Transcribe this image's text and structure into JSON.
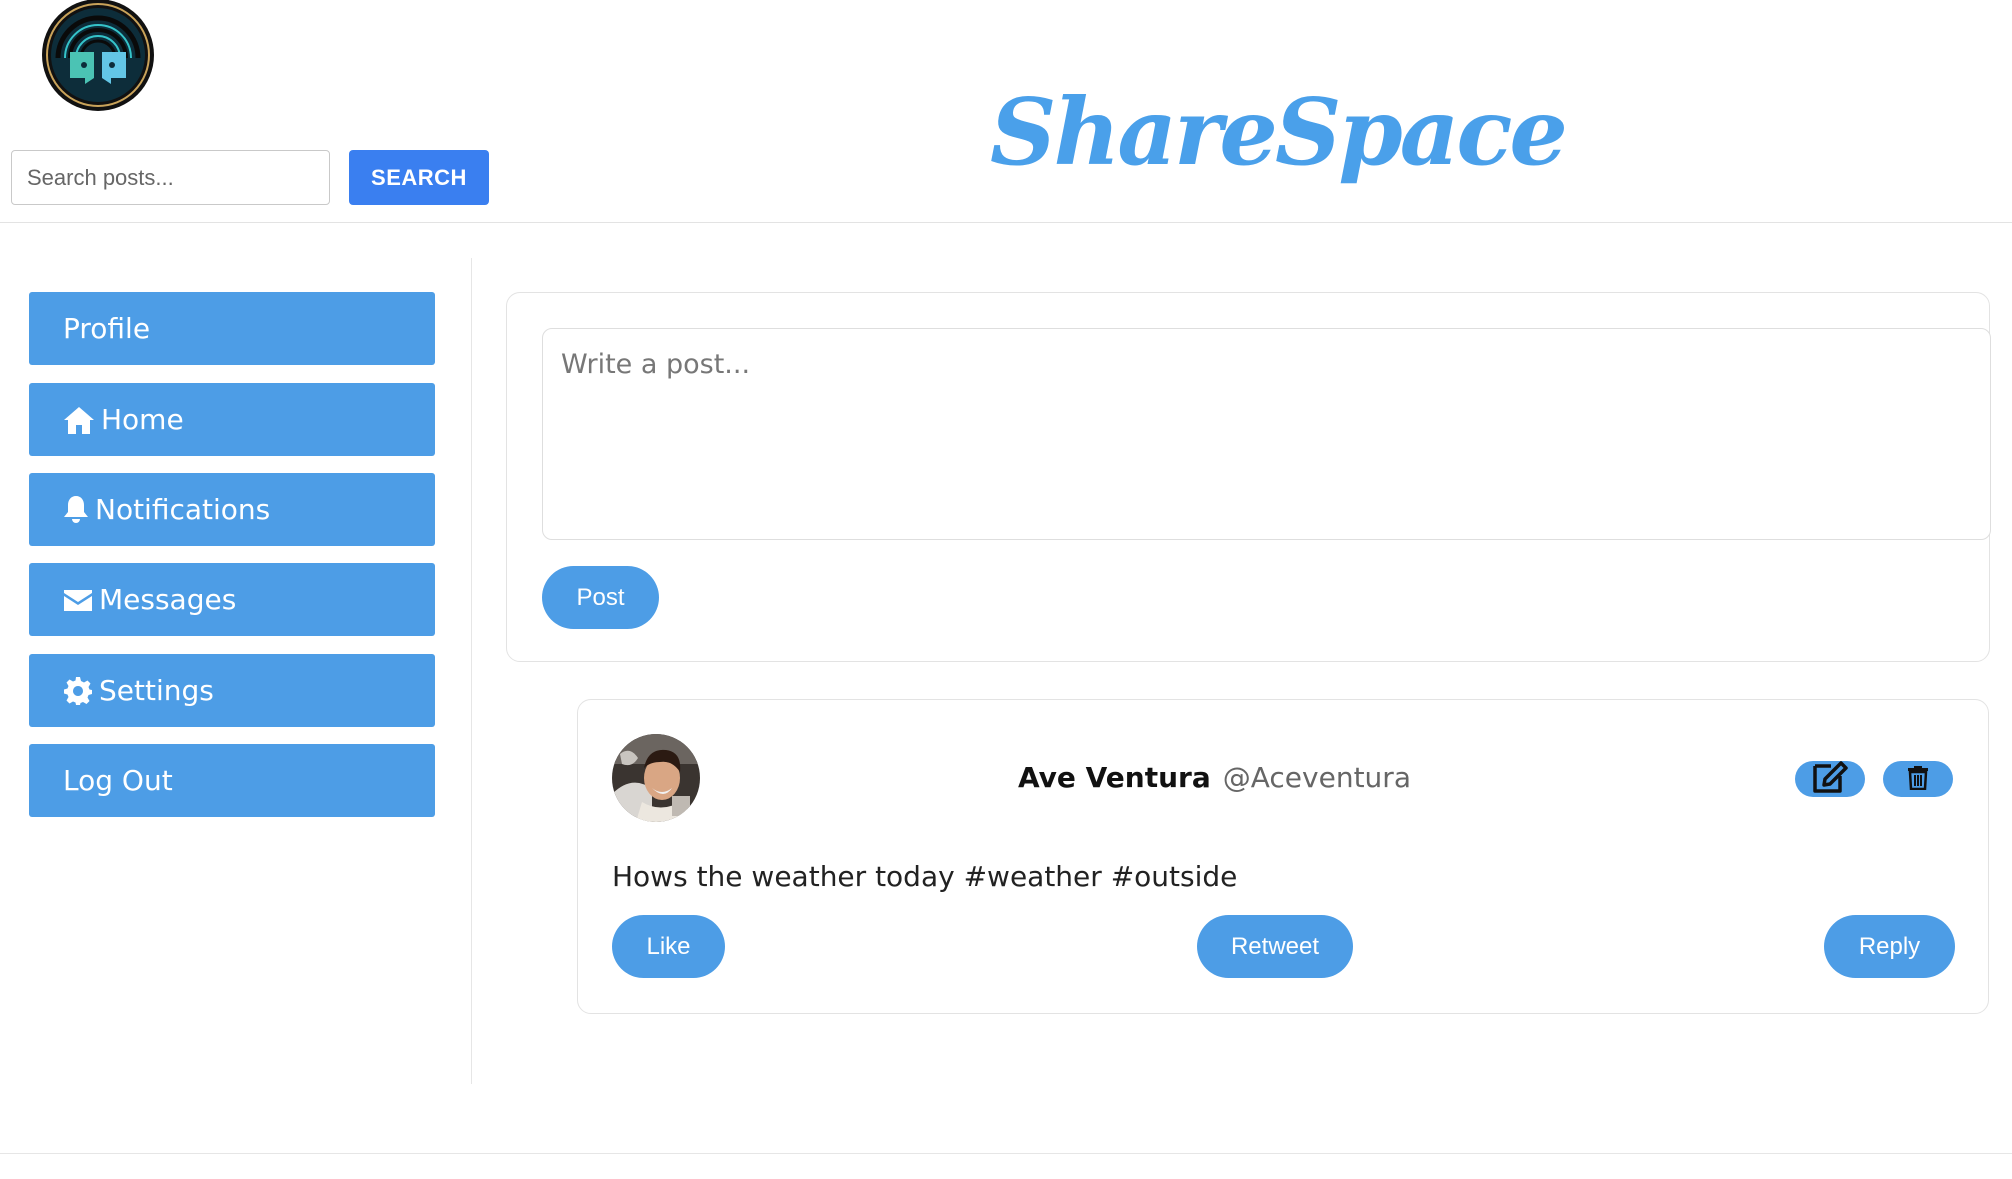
{
  "header": {
    "brand": "ShareSpace",
    "search": {
      "placeholder": "Search posts...",
      "value": ""
    },
    "search_button": "SEARCH",
    "logo_icon": "sharespace-logo-icon"
  },
  "sidebar": {
    "items": [
      {
        "label": "Profile",
        "icon": ""
      },
      {
        "label": "Home",
        "icon": "home-icon"
      },
      {
        "label": "Notifications",
        "icon": "bell-icon"
      },
      {
        "label": "Messages",
        "icon": "envelope-icon"
      },
      {
        "label": "Settings",
        "icon": "gear-icon"
      },
      {
        "label": "Log Out",
        "icon": ""
      }
    ]
  },
  "composer": {
    "placeholder": "Write a post...",
    "value": "",
    "post_button": "Post"
  },
  "feed": {
    "posts": [
      {
        "author_name": "Ave Ventura",
        "handle": "@Aceventura",
        "text": "Hows the weather today #weather #outside",
        "actions": {
          "like": "Like",
          "retweet": "Retweet",
          "reply": "Reply"
        },
        "edit_icon": "edit-icon",
        "delete_icon": "trash-icon"
      }
    ]
  },
  "colors": {
    "accent": "#4d9de6",
    "search_button": "#3a7ff0",
    "brand": "#4aa0ea"
  }
}
